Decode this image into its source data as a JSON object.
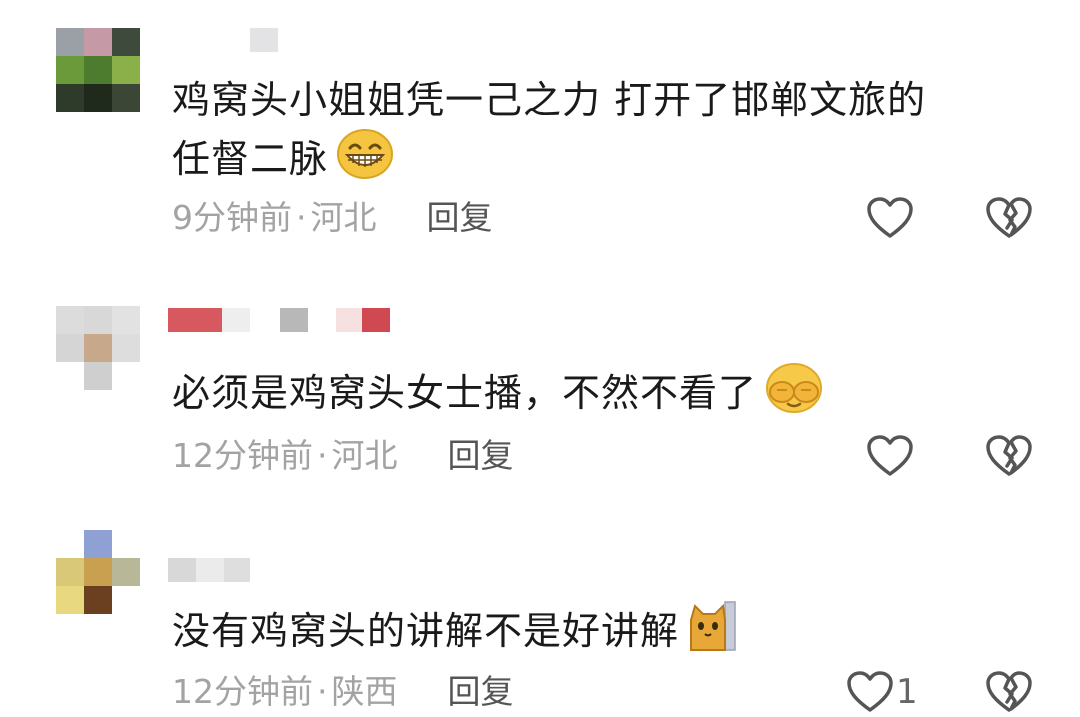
{
  "comments": [
    {
      "text_line1": "鸡窝头小姐姐凭一己之力 打开了邯郸文旅的",
      "text_line2": "任督二脉",
      "emoji": "grinning-face-emoji",
      "time": "9分钟前",
      "sep": "·",
      "location": "河北",
      "reply_label": "回复",
      "like_count": ""
    },
    {
      "text_line1": "必须是鸡窝头女士播，不然不看了",
      "emoji": "face-covering-eyes-emoji",
      "time": "12分钟前",
      "sep": "·",
      "location": "河北",
      "reply_label": "回复",
      "like_count": ""
    },
    {
      "text_line1": "没有鸡窝头的讲解不是好讲解",
      "emoji": "cat-peeking-emoji",
      "time": "12分钟前",
      "sep": "·",
      "location": "陕西",
      "reply_label": "回复",
      "like_count": "1"
    }
  ],
  "colors": {
    "meta_gray": "#a3a3a3",
    "reply_gray": "#555555",
    "icon_gray": "#555555",
    "emoji_yellow": "#f5c542"
  }
}
